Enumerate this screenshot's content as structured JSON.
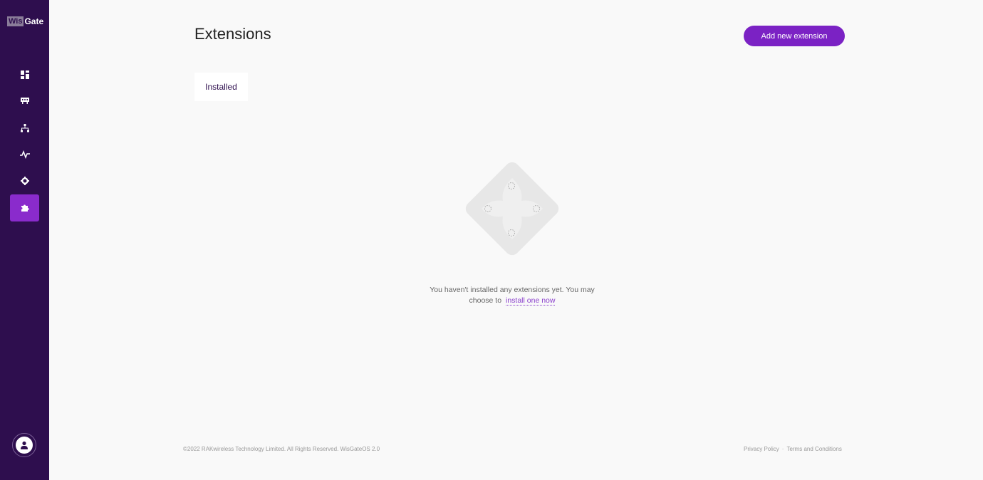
{
  "sidebar": {
    "logo_prefix": "Wis",
    "logo_suffix": "Gate",
    "items": [
      {
        "icon": "dashboard-icon"
      },
      {
        "icon": "gateway-icon"
      },
      {
        "icon": "network-icon"
      },
      {
        "icon": "activity-icon"
      },
      {
        "icon": "settings-icon"
      },
      {
        "icon": "puzzle-icon",
        "active": true
      }
    ],
    "user_icon": "user-icon"
  },
  "header": {
    "title": "Extensions",
    "add_button_label": "Add new extension"
  },
  "tabs": [
    {
      "label": "Installed",
      "active": true
    }
  ],
  "empty_state": {
    "illustration": "puzzle-illustration",
    "message": "You haven't installed any extensions yet. You may choose to",
    "link_label": "install one now"
  },
  "footer": {
    "copyright": "©2022 RAKwireless Technology Limited. All Rights Reserved. WisGateOS 2.0",
    "privacy": "Privacy Policy",
    "separator": "·",
    "terms": "Terms and Conditions"
  },
  "colors": {
    "sidebar_bg": "#2e0e4e",
    "accent": "#7b22c4",
    "active_nav": "#8a2bcc",
    "page_bg": "#f9f9f9"
  }
}
